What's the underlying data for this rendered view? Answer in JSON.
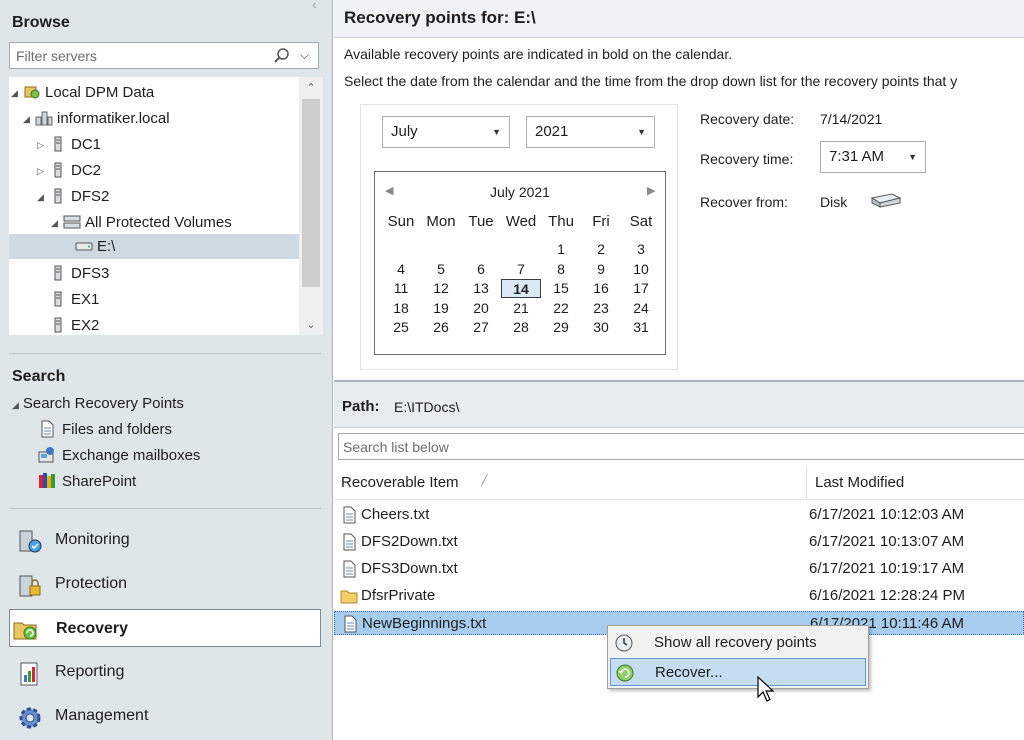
{
  "left": {
    "browse_title": "Browse",
    "filter_placeholder": "Filter servers",
    "tree": [
      {
        "label": "Local DPM Data",
        "expanded": true
      },
      {
        "label": "informatiker.local",
        "expanded": true
      },
      {
        "label": "DC1",
        "expanded": false
      },
      {
        "label": "DC2",
        "expanded": false
      },
      {
        "label": "DFS2",
        "expanded": true
      },
      {
        "label": "All Protected Volumes",
        "expanded": true
      },
      {
        "label": "E:\\",
        "selected": true
      },
      {
        "label": "DFS3"
      },
      {
        "label": "EX1"
      },
      {
        "label": "EX2"
      }
    ],
    "search_title": "Search",
    "search_root": "Search Recovery Points",
    "search_items": [
      "Files and folders",
      "Exchange mailboxes",
      "SharePoint"
    ],
    "nav": [
      {
        "label": "Monitoring",
        "icon": "monitoring-icon"
      },
      {
        "label": "Protection",
        "icon": "protection-icon"
      },
      {
        "label": "Recovery",
        "icon": "recovery-icon",
        "active": true
      },
      {
        "label": "Reporting",
        "icon": "reporting-icon"
      },
      {
        "label": "Management",
        "icon": "management-icon"
      }
    ]
  },
  "recovery_points": {
    "header": "Recovery points for:  E:\\",
    "info_line1": "Available recovery points are indicated in bold on the calendar.",
    "info_line2": "Select the date from the calendar and the time from the drop down list for the recovery points that y",
    "month_select": "July",
    "year_select": "2021",
    "calendar": {
      "title": "July 2021",
      "weekdays": [
        "Sun",
        "Mon",
        "Tue",
        "Wed",
        "Thu",
        "Fri",
        "Sat"
      ],
      "first_weekday_index": 4,
      "days_in_month": 31,
      "selected_day": 14
    },
    "recovery_date_label": "Recovery date:",
    "recovery_date_value": "7/14/2021",
    "recovery_time_label": "Recovery time:",
    "recovery_time_value": "7:31 AM",
    "recover_from_label": "Recover from:",
    "recover_from_value": "Disk"
  },
  "file_list": {
    "path_label": "Path:",
    "path_value": "E:\\ITDocs\\",
    "search_placeholder": "Search list below",
    "columns": {
      "item": "Recoverable Item",
      "modified": "Last Modified"
    },
    "rows": [
      {
        "name": "Cheers.txt",
        "modified": "6/17/2021 10:12:03 AM",
        "type": "file"
      },
      {
        "name": "DFS2Down.txt",
        "modified": "6/17/2021 10:13:07 AM",
        "type": "file"
      },
      {
        "name": "DFS3Down.txt",
        "modified": "6/17/2021 10:19:17 AM",
        "type": "file"
      },
      {
        "name": "DfsrPrivate",
        "modified": "6/16/2021 12:28:24 PM",
        "type": "folder"
      },
      {
        "name": "NewBeginnings.txt",
        "modified": "6/17/2021 10:11:46 AM",
        "type": "file",
        "selected": true
      }
    ]
  },
  "context_menu": {
    "items": [
      {
        "label": "Show all recovery points",
        "icon": "clock-icon"
      },
      {
        "label": "Recover...",
        "icon": "recover-icon",
        "highlighted": true
      }
    ]
  }
}
